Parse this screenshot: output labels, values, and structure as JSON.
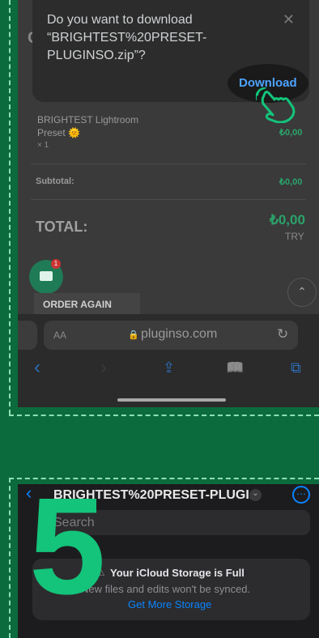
{
  "download_dialog": {
    "message": "Do you want to download “BRIGHTEST%20PRESET-PLUGINSO.zip”?",
    "close": "✕",
    "download_label": "Download"
  },
  "cart": {
    "partial_heading": "C",
    "item_name": "BRIGHTEST Lightroom",
    "item_name_2": "Preset 🌞",
    "item_qty": "× 1",
    "item_price": "₺0,00",
    "subtotal_label": "Subtotal:",
    "subtotal_value": "₺0,00",
    "total_label": "TOTAL:",
    "total_value": "₺0,00",
    "total_currency": "TRY",
    "order_again_label": "ORDER AGAIN",
    "chat_badge": "1",
    "up_arrow": "⌃"
  },
  "browser": {
    "aa_label": "AA",
    "url": "pluginso.com",
    "lock": "🔒",
    "reload": "↻",
    "back": "‹",
    "forward": "›",
    "share": "⇪",
    "bookmarks": "📖",
    "tabs": "⧉"
  },
  "files": {
    "step_number": "5",
    "back": "‹",
    "folder_title": "BRIGHTEST%20PRESET-PLUGI...",
    "chevron": "⌄",
    "more": "⋯",
    "search_placeholder": "Search",
    "warning_icon": "⚠",
    "icloud_title": "Your iCloud Storage is Full",
    "icloud_subtitle": "New files and edits won't be synced.",
    "icloud_link": "Get More Storage"
  },
  "colors": {
    "background": "#0b6b3c",
    "accent_green": "#13c47a",
    "link_blue": "#4da3ff"
  }
}
